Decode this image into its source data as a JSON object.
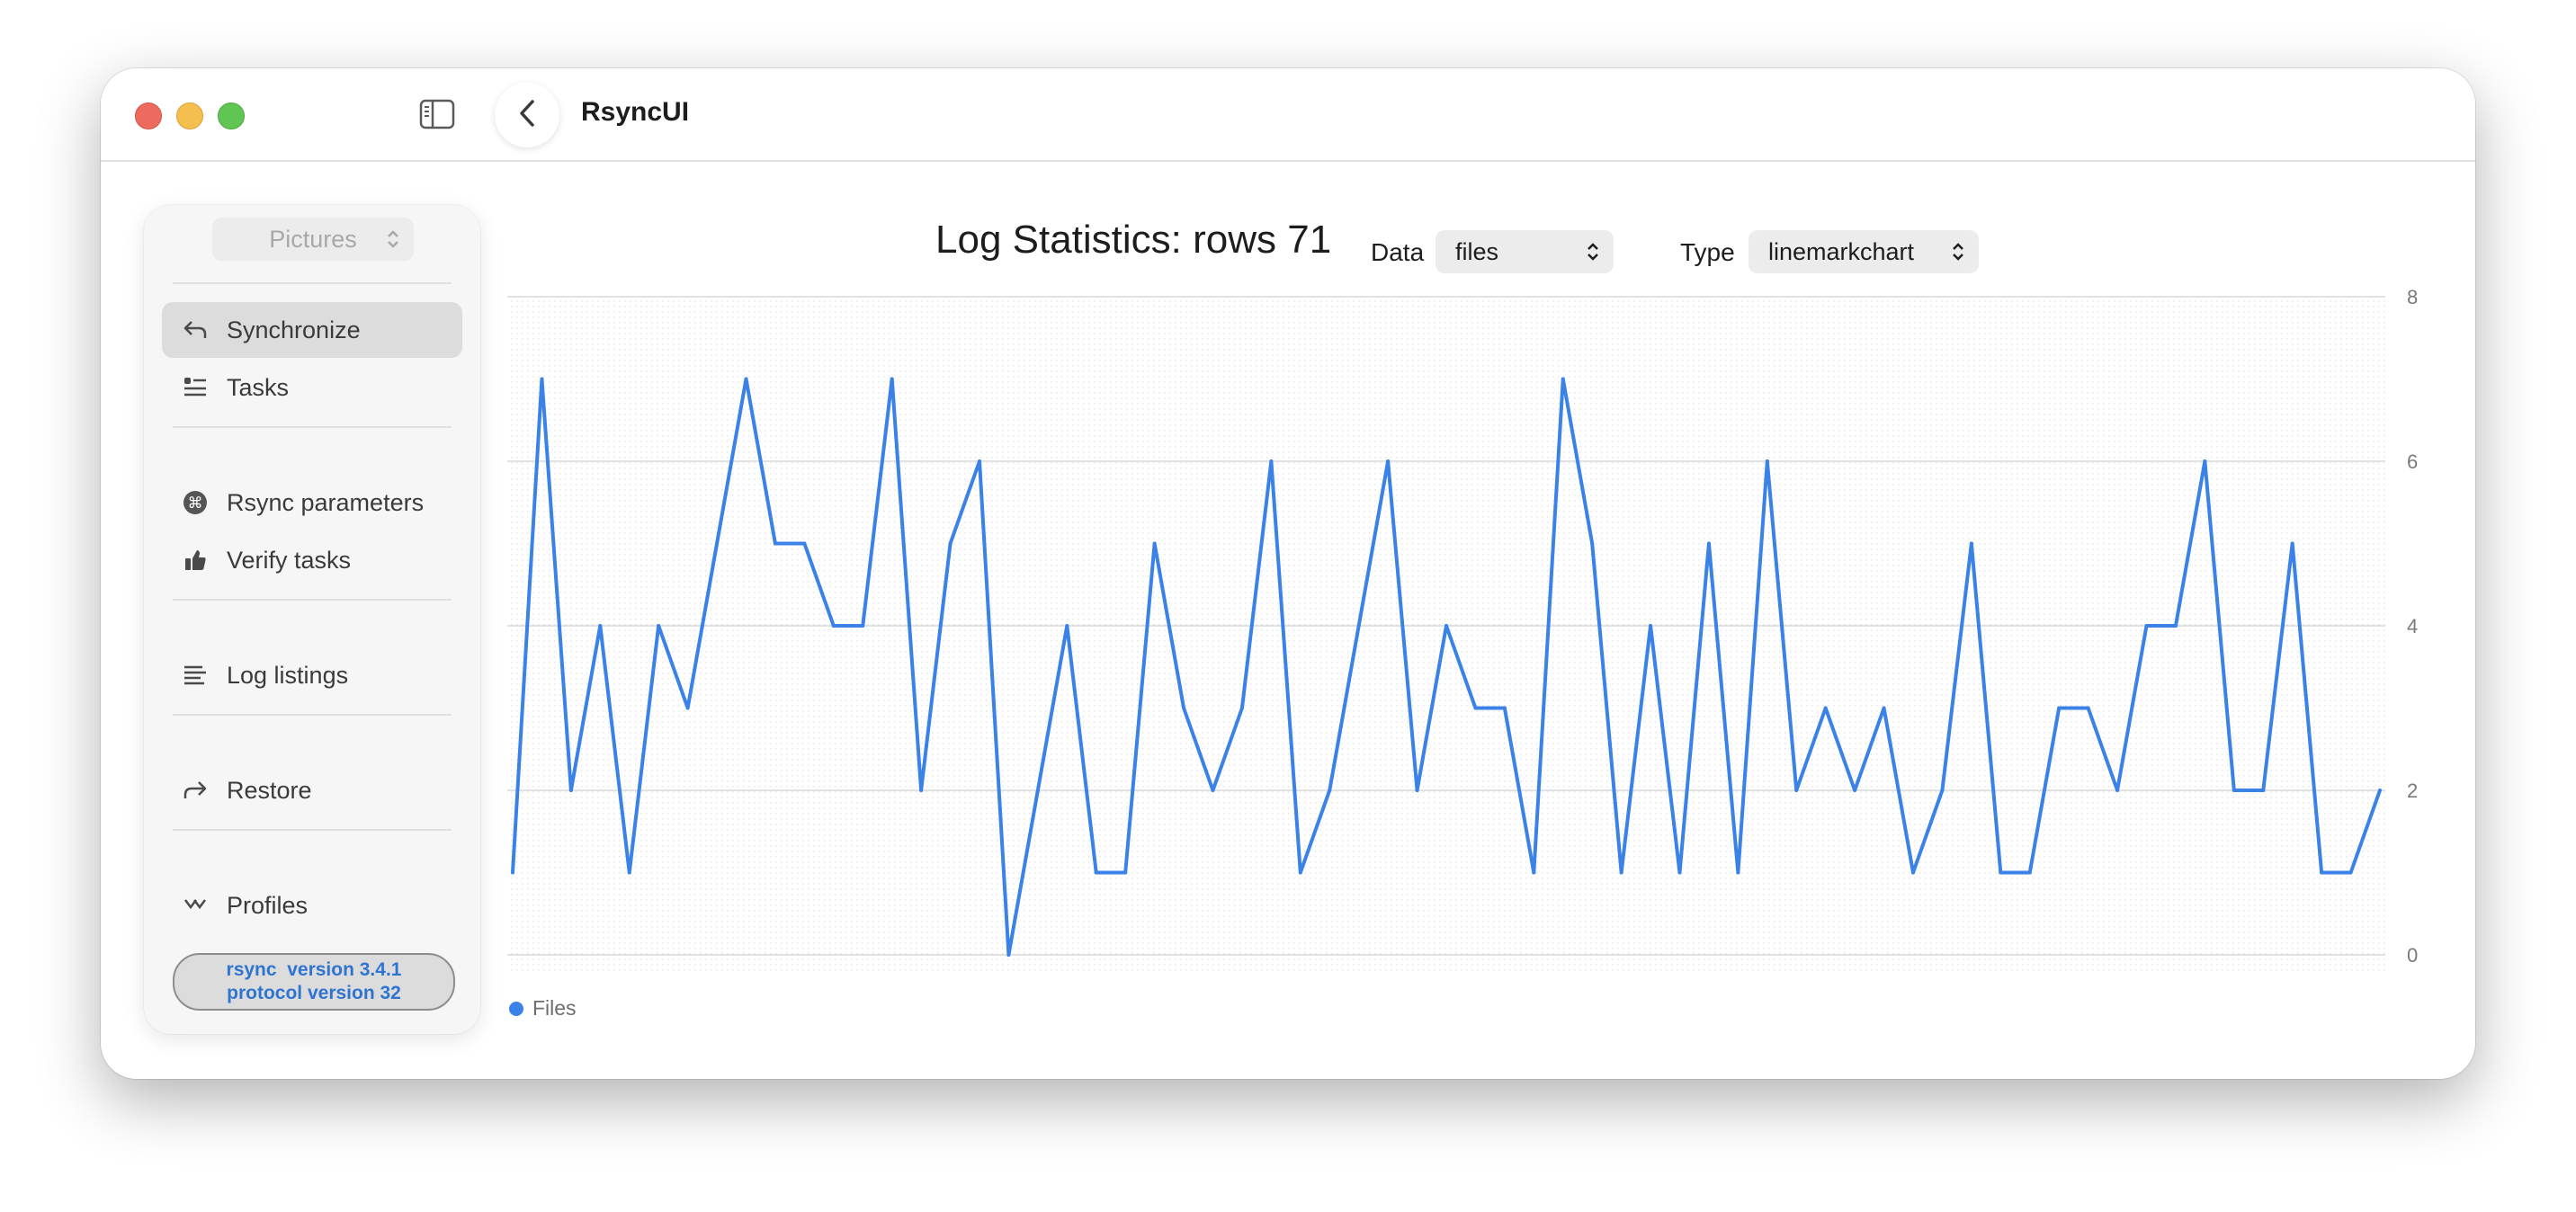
{
  "app": {
    "title": "RsyncUI"
  },
  "icons": {
    "sidebar_toggle": "sidebar-left-icon",
    "back": "chevron-left-icon",
    "synchronize": "arrow-uturn-left-icon",
    "tasks": "list-bullet-icon",
    "rsync_parameters": "command-icon",
    "verify_tasks": "thumbs-up-icon",
    "log_listings": "text-lines-icon",
    "restore": "arrow-uturn-right-icon",
    "profiles": "profiles-icon"
  },
  "sidebar": {
    "profile_select": "Pictures",
    "items": [
      {
        "label": "Synchronize",
        "active": true
      },
      {
        "label": "Tasks"
      },
      {
        "label": "Rsync parameters"
      },
      {
        "label": "Verify tasks"
      },
      {
        "label": "Log listings"
      },
      {
        "label": "Restore"
      },
      {
        "label": "Profiles"
      }
    ],
    "version_line1": "rsync  version 3.4.1",
    "version_line2": "protocol version 32"
  },
  "header": {
    "title": "Log Statistics: rows 71",
    "data_label": "Data",
    "data_value": "files",
    "type_label": "Type",
    "type_value": "linemarkchart"
  },
  "colors": {
    "accent": "#3a82e8",
    "grid": "#d8d8d8"
  },
  "chart_data": {
    "type": "line",
    "series": [
      {
        "name": "Files",
        "values": [
          1,
          7,
          2,
          4,
          1,
          4,
          3,
          5,
          7,
          5,
          5,
          4,
          4,
          7,
          2,
          5,
          6,
          0,
          2,
          4,
          1,
          1,
          5,
          3,
          2,
          3,
          6,
          1,
          2,
          4,
          6,
          2,
          4,
          3,
          3,
          1,
          7,
          5,
          1,
          4,
          1,
          5,
          1,
          6,
          2,
          3,
          2,
          3,
          1,
          2,
          5,
          1,
          1,
          3,
          3,
          2,
          4,
          4,
          6,
          2,
          2,
          5,
          1,
          1,
          2
        ]
      }
    ],
    "ylim": [
      0,
      8
    ],
    "y_ticks": [
      0,
      2,
      4,
      6,
      8
    ],
    "grid": true,
    "legend": "bottom-left"
  }
}
